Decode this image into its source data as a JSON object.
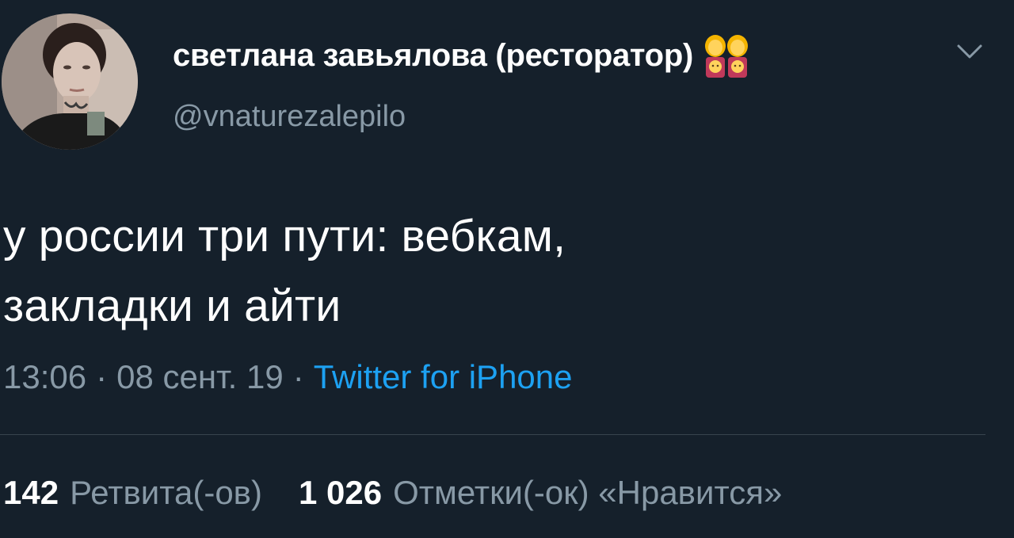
{
  "tweet": {
    "author": {
      "display_name": "светлана завьялова (ресторатор)",
      "name_emoji": "family-two-women-two-girls",
      "username": "@vnaturezalepilo"
    },
    "text_lines": [
      "у россии три пути: вебкам,",
      "закладки и айти"
    ],
    "time": "13:06",
    "separator": "·",
    "date": "08 сент. 19",
    "source": "Twitter for iPhone",
    "stats": {
      "retweets_count": "142",
      "retweets_label": "Ретвита(-ов)",
      "likes_count": "1 026",
      "likes_label": "Отметки(-ок) «Нравится»"
    }
  },
  "icons": {
    "caret": "chevron-down-icon",
    "avatar": "user-avatar"
  },
  "colors": {
    "background": "#15202b",
    "secondary_text": "#8899a6",
    "link": "#1da1f2",
    "divider": "#38444d"
  }
}
